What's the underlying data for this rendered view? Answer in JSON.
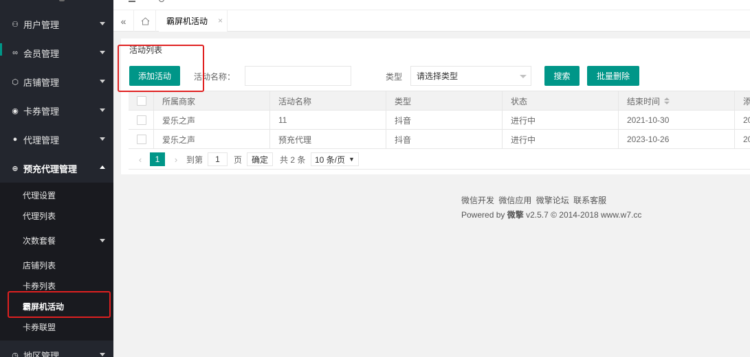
{
  "sidebar": {
    "items": [
      {
        "label": "用户管理",
        "icon": "user-group-icon"
      },
      {
        "label": "会员管理",
        "icon": "infinity-icon"
      },
      {
        "label": "店铺管理",
        "icon": "cube-icon"
      },
      {
        "label": "卡券管理",
        "icon": "circle-dot-icon"
      },
      {
        "label": "代理管理",
        "icon": "user-icon"
      },
      {
        "label": "预充代理管理",
        "icon": "plus-circle-icon"
      },
      {
        "label": "地区管理",
        "icon": "clock-icon"
      }
    ],
    "sub_items": [
      "代理设置",
      "代理列表",
      "次数套餐",
      "店铺列表",
      "卡券列表",
      "霸屏机活动",
      "卡券联盟"
    ]
  },
  "tabs": {
    "home_icon": "home-icon",
    "active_label": "霸屏机活动",
    "close_glyph": "×",
    "collapse_glyph": "«"
  },
  "panel": {
    "title": "活动列表",
    "add_button": "添加活动",
    "name_label": "活动名称：",
    "name_value": "",
    "type_label": "类型",
    "type_select": "请选择类型",
    "search_button": "搜索",
    "bulk_delete_button": "批量删除"
  },
  "table": {
    "headers": [
      "所属商家",
      "活动名称",
      "类型",
      "状态",
      "结束时间",
      "添"
    ],
    "rows": [
      [
        "爱乐之声",
        "11",
        "抖音",
        "进行中",
        "2021-10-30",
        "20"
      ],
      [
        "爱乐之声",
        "预充代理",
        "抖音",
        "进行中",
        "2023-10-26",
        "20"
      ]
    ]
  },
  "pager": {
    "prev": "‹",
    "current": "1",
    "next": "›",
    "goto_label": "到第",
    "goto_value": "1",
    "page_label": "页",
    "confirm": "确定",
    "total": "共 2 条",
    "page_size": "10 条/页"
  },
  "footer": {
    "links": [
      "微信开发",
      "微信应用",
      "微擎论坛",
      "联系客服"
    ],
    "powered_prefix": "Powered by",
    "brand": "微擎",
    "version": "v2.5.7 © 2014-2018",
    "site": "www.w7.cc"
  },
  "colors": {
    "accent": "#009688",
    "sidebar_bg": "#23262e",
    "highlight": "#e02020"
  }
}
